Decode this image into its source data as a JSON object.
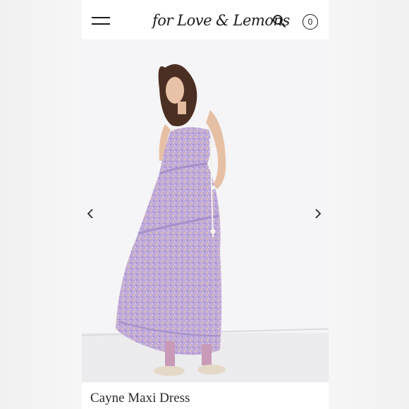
{
  "header": {
    "brand_logo": "for Love & Lemons",
    "menu_icon": "hamburger-menu-icon",
    "search_icon": "search-icon",
    "cart_icon": "cart-count-icon",
    "cart_count": "0"
  },
  "gallery": {
    "image_alt": "model wearing lavender floral maxi dress",
    "prev_icon": "chevron-left-icon",
    "next_icon": "chevron-right-icon"
  },
  "product": {
    "title": "Cayne Maxi Dress"
  },
  "colors": {
    "dress": "#b7a3d3",
    "dress_accent": "#e9c9a1",
    "background": "#f5f4f6"
  }
}
